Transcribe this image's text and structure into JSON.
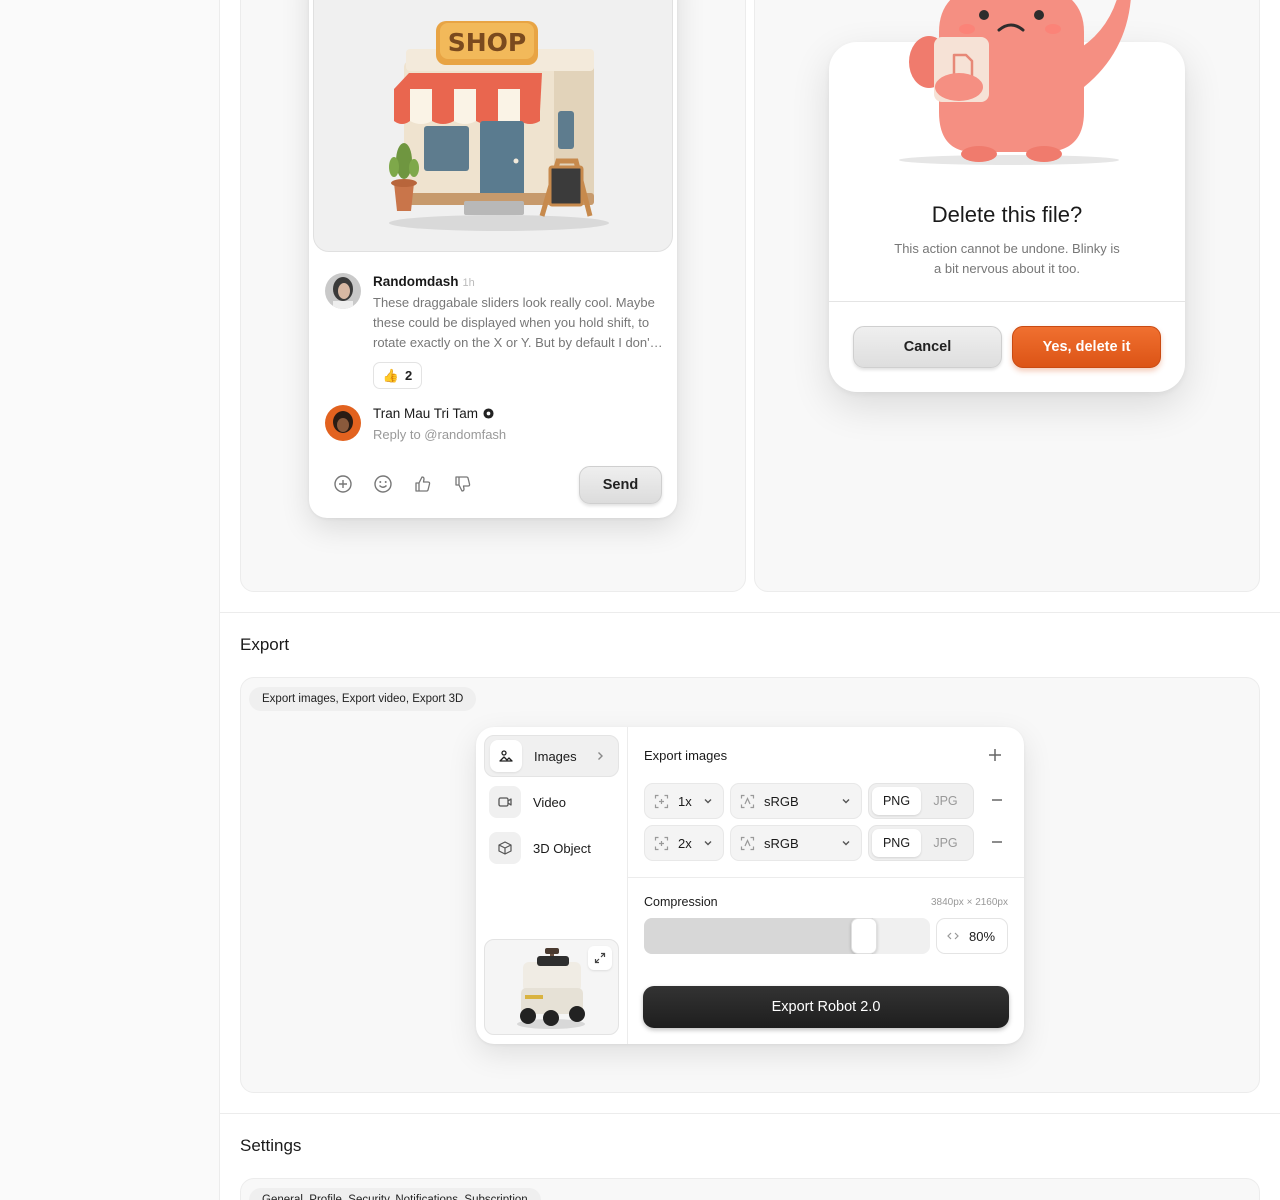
{
  "comments": {
    "first": {
      "name": "Randomdash",
      "time": "1h",
      "text": "These draggabale sliders look really cool. Maybe these could be displayed when you hold shift, to rotate exactly on the X or Y. But by default I don'…",
      "reaction_emoji": "👍",
      "reaction_count": "2"
    },
    "reply": {
      "name": "Tran Mau Tri Tam",
      "placeholder": "Reply to @randomfash"
    },
    "send_label": "Send",
    "shop_sign": "SHOP"
  },
  "dialog": {
    "title": "Delete this file?",
    "text": "This action cannot be undone. Blinky is a bit nervous about it too.",
    "cancel_label": "Cancel",
    "confirm_label": "Yes, delete it"
  },
  "sections": {
    "export": {
      "title": "Export",
      "chip": "Export images, Export video, Export 3D"
    },
    "settings": {
      "title": "Settings",
      "chip": "General, Profile, Security, Notifications, Subscription"
    }
  },
  "export_panel": {
    "nav": [
      {
        "label": "Images",
        "active": true
      },
      {
        "label": "Video",
        "active": false
      },
      {
        "label": "3D Object",
        "active": false
      }
    ],
    "title": "Export images",
    "rows": [
      {
        "scale": "1x",
        "colorspace": "sRGB",
        "formats": [
          "PNG",
          "JPG"
        ],
        "selected": "PNG"
      },
      {
        "scale": "2x",
        "colorspace": "sRGB",
        "formats": [
          "PNG",
          "JPG"
        ],
        "selected": "PNG"
      }
    ],
    "compression_label": "Compression",
    "dimensions": "3840px × 2160px",
    "compression_value": 0.8,
    "compression_text": "80%",
    "export_label": "Export Robot 2.0"
  },
  "colors": {
    "accent_orange": "#e2591b",
    "primary_dark": "#262626"
  }
}
